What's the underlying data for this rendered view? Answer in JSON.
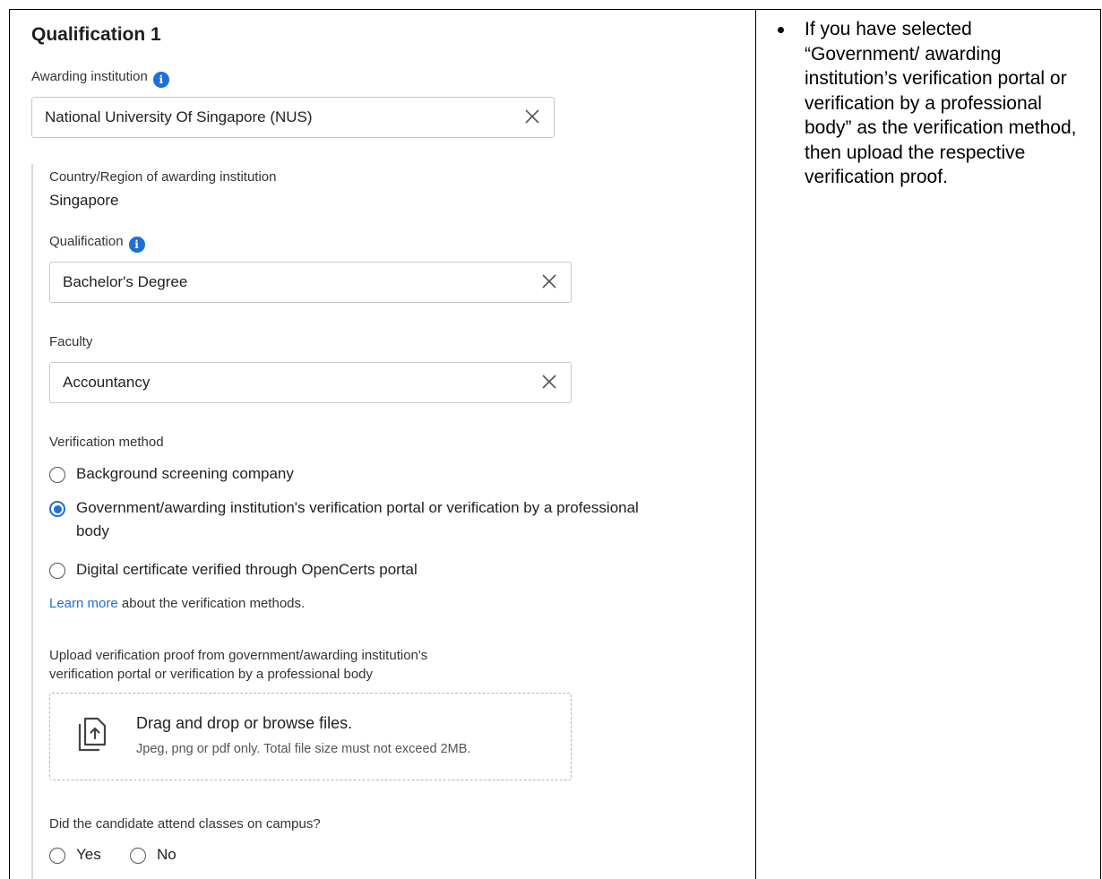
{
  "form": {
    "title": "Qualification 1",
    "awarding_institution": {
      "label": "Awarding institution",
      "value": "National University Of Singapore (NUS)"
    },
    "country": {
      "label": "Country/Region of awarding institution",
      "value": "Singapore"
    },
    "qualification": {
      "label": "Qualification",
      "value": "Bachelor's Degree"
    },
    "faculty": {
      "label": "Faculty",
      "value": "Accountancy"
    },
    "verification": {
      "label": "Verification method",
      "options": [
        {
          "label": "Background screening company",
          "checked": false
        },
        {
          "label": "Government/awarding institution's verification portal or verification by a professional",
          "label_line2": "body",
          "checked": true
        },
        {
          "label": "Digital certificate verified through OpenCerts portal",
          "checked": false
        }
      ],
      "learn_more_link": "Learn more",
      "learn_more_rest": " about the verification methods."
    },
    "upload": {
      "label_line1": "Upload verification proof from government/awarding institution's",
      "label_line2": "verification portal or verification by a professional body",
      "drop_text": "Drag and drop or browse files.",
      "hint": "Jpeg, png or pdf only. Total file size must not exceed 2MB."
    },
    "campus": {
      "label": "Did the candidate attend classes on campus?",
      "options": [
        "Yes",
        "No"
      ]
    }
  },
  "note": {
    "text": "If you have selected “Government/ awarding institution’s verification portal or verification by a professional body” as the verification method, then upload the respective verification proof."
  },
  "colors": {
    "accent": "#1f6fd6",
    "border": "#c8c8c8"
  }
}
